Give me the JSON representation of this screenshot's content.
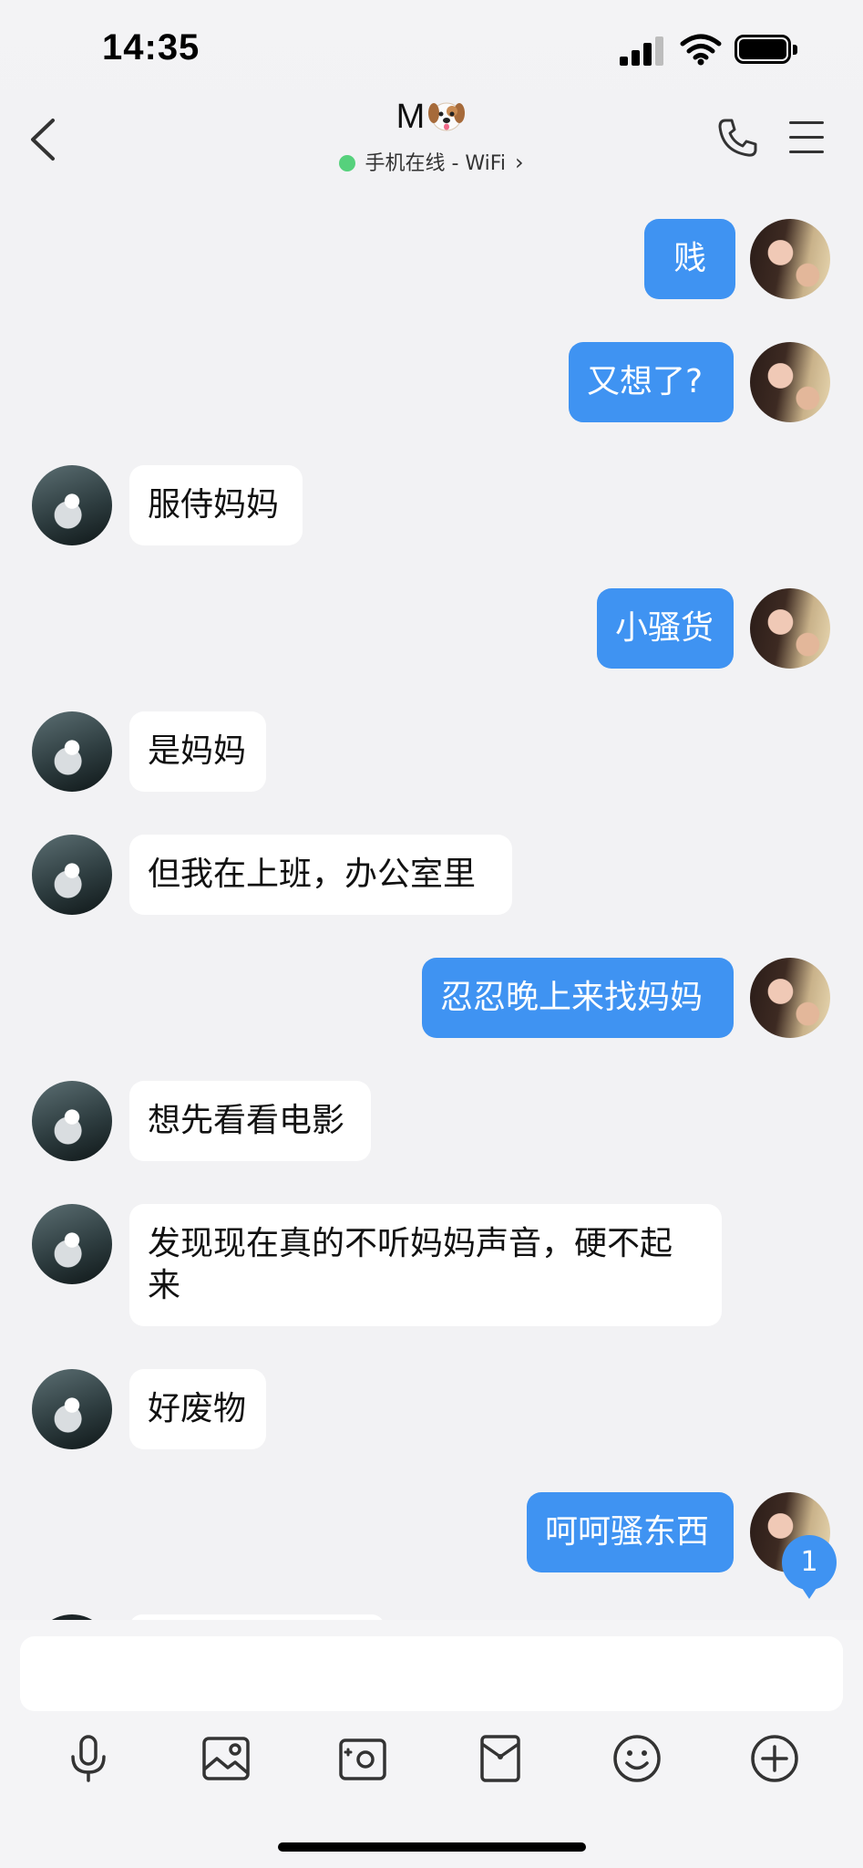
{
  "status_bar": {
    "time": "14:35"
  },
  "header": {
    "contact_name": "M",
    "contact_emoji_icon": "dog-face-icon",
    "status_text": "手机在线 - WiFi",
    "status_color": "#56d17c"
  },
  "messages": [
    {
      "sender": "me",
      "text": "贱"
    },
    {
      "sender": "me",
      "text": "又想了?"
    },
    {
      "sender": "other",
      "text": "服侍妈妈"
    },
    {
      "sender": "me",
      "text": "小骚货"
    },
    {
      "sender": "other",
      "text": "是妈妈"
    },
    {
      "sender": "other",
      "text": "但我在上班，办公室里"
    },
    {
      "sender": "me",
      "text": "忍忍晚上来找妈妈"
    },
    {
      "sender": "other",
      "text": "想先看看电影"
    },
    {
      "sender": "other",
      "text": "发现现在真的不听妈妈声音，硬不起来"
    },
    {
      "sender": "other",
      "text": "好废物"
    },
    {
      "sender": "me",
      "text": "呵呵骚东西"
    }
  ],
  "unread_badge": "1",
  "toolbar_icons": [
    "microphone-icon",
    "image-icon",
    "camera-icon",
    "red-packet-icon",
    "emoji-icon",
    "plus-icon"
  ],
  "colors": {
    "accent": "#3f93f2",
    "background": "#f2f2f4",
    "bubble_other": "#ffffff"
  }
}
